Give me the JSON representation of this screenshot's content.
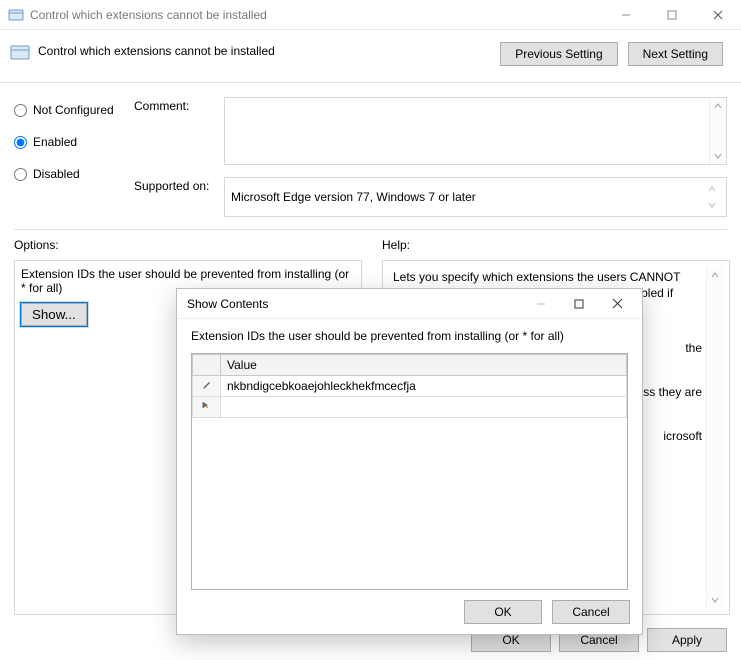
{
  "window": {
    "title": "Control which extensions cannot be installed"
  },
  "header": {
    "title": "Control which extensions cannot be installed",
    "prev_btn": "Previous Setting",
    "next_btn": "Next Setting"
  },
  "state": {
    "not_configured": "Not Configured",
    "enabled": "Enabled",
    "disabled": "Disabled",
    "selected": "enabled"
  },
  "comment": {
    "label": "Comment:",
    "value": ""
  },
  "supported": {
    "label": "Supported on:",
    "value": "Microsoft Edge version 77, Windows 7 or later"
  },
  "sections": {
    "options_label": "Options:",
    "help_label": "Help:"
  },
  "options": {
    "text": "Extension IDs the user should be prevented from installing (or * for all)",
    "show_btn": "Show..."
  },
  "help": {
    "visible": "Lets you specify which extensions the users CANNOT install. Extensions already installed will be disabled if blocked, without a way for the user",
    "trail1": "the",
    "trail2": "ss they are",
    "trail3": "icrosoft"
  },
  "footer": {
    "ok": "OK",
    "cancel": "Cancel",
    "apply": "Apply"
  },
  "modal": {
    "title": "Show Contents",
    "desc": "Extension IDs the user should be prevented from installing (or * for all)",
    "column_header": "Value",
    "rows": [
      {
        "kind": "edit",
        "value": "nkbndigcebkoaejohleckhekfmcecfja"
      },
      {
        "kind": "new",
        "value": ""
      }
    ],
    "ok": "OK",
    "cancel": "Cancel"
  }
}
